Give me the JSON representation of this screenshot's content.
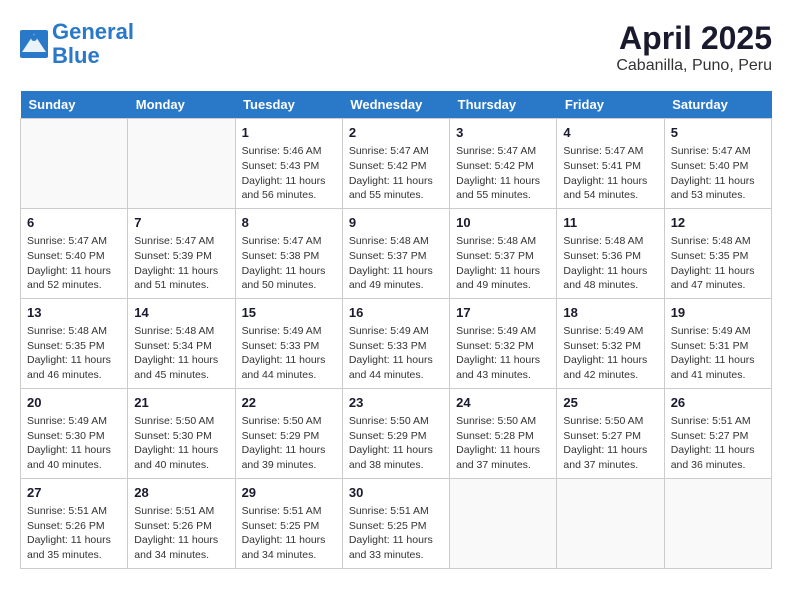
{
  "logo": {
    "line1": "General",
    "line2": "Blue"
  },
  "title": "April 2025",
  "subtitle": "Cabanilla, Puno, Peru",
  "weekdays": [
    "Sunday",
    "Monday",
    "Tuesday",
    "Wednesday",
    "Thursday",
    "Friday",
    "Saturday"
  ],
  "weeks": [
    [
      {
        "day": "",
        "info": ""
      },
      {
        "day": "",
        "info": ""
      },
      {
        "day": "1",
        "info": "Sunrise: 5:46 AM\nSunset: 5:43 PM\nDaylight: 11 hours and 56 minutes."
      },
      {
        "day": "2",
        "info": "Sunrise: 5:47 AM\nSunset: 5:42 PM\nDaylight: 11 hours and 55 minutes."
      },
      {
        "day": "3",
        "info": "Sunrise: 5:47 AM\nSunset: 5:42 PM\nDaylight: 11 hours and 55 minutes."
      },
      {
        "day": "4",
        "info": "Sunrise: 5:47 AM\nSunset: 5:41 PM\nDaylight: 11 hours and 54 minutes."
      },
      {
        "day": "5",
        "info": "Sunrise: 5:47 AM\nSunset: 5:40 PM\nDaylight: 11 hours and 53 minutes."
      }
    ],
    [
      {
        "day": "6",
        "info": "Sunrise: 5:47 AM\nSunset: 5:40 PM\nDaylight: 11 hours and 52 minutes."
      },
      {
        "day": "7",
        "info": "Sunrise: 5:47 AM\nSunset: 5:39 PM\nDaylight: 11 hours and 51 minutes."
      },
      {
        "day": "8",
        "info": "Sunrise: 5:47 AM\nSunset: 5:38 PM\nDaylight: 11 hours and 50 minutes."
      },
      {
        "day": "9",
        "info": "Sunrise: 5:48 AM\nSunset: 5:37 PM\nDaylight: 11 hours and 49 minutes."
      },
      {
        "day": "10",
        "info": "Sunrise: 5:48 AM\nSunset: 5:37 PM\nDaylight: 11 hours and 49 minutes."
      },
      {
        "day": "11",
        "info": "Sunrise: 5:48 AM\nSunset: 5:36 PM\nDaylight: 11 hours and 48 minutes."
      },
      {
        "day": "12",
        "info": "Sunrise: 5:48 AM\nSunset: 5:35 PM\nDaylight: 11 hours and 47 minutes."
      }
    ],
    [
      {
        "day": "13",
        "info": "Sunrise: 5:48 AM\nSunset: 5:35 PM\nDaylight: 11 hours and 46 minutes."
      },
      {
        "day": "14",
        "info": "Sunrise: 5:48 AM\nSunset: 5:34 PM\nDaylight: 11 hours and 45 minutes."
      },
      {
        "day": "15",
        "info": "Sunrise: 5:49 AM\nSunset: 5:33 PM\nDaylight: 11 hours and 44 minutes."
      },
      {
        "day": "16",
        "info": "Sunrise: 5:49 AM\nSunset: 5:33 PM\nDaylight: 11 hours and 44 minutes."
      },
      {
        "day": "17",
        "info": "Sunrise: 5:49 AM\nSunset: 5:32 PM\nDaylight: 11 hours and 43 minutes."
      },
      {
        "day": "18",
        "info": "Sunrise: 5:49 AM\nSunset: 5:32 PM\nDaylight: 11 hours and 42 minutes."
      },
      {
        "day": "19",
        "info": "Sunrise: 5:49 AM\nSunset: 5:31 PM\nDaylight: 11 hours and 41 minutes."
      }
    ],
    [
      {
        "day": "20",
        "info": "Sunrise: 5:49 AM\nSunset: 5:30 PM\nDaylight: 11 hours and 40 minutes."
      },
      {
        "day": "21",
        "info": "Sunrise: 5:50 AM\nSunset: 5:30 PM\nDaylight: 11 hours and 40 minutes."
      },
      {
        "day": "22",
        "info": "Sunrise: 5:50 AM\nSunset: 5:29 PM\nDaylight: 11 hours and 39 minutes."
      },
      {
        "day": "23",
        "info": "Sunrise: 5:50 AM\nSunset: 5:29 PM\nDaylight: 11 hours and 38 minutes."
      },
      {
        "day": "24",
        "info": "Sunrise: 5:50 AM\nSunset: 5:28 PM\nDaylight: 11 hours and 37 minutes."
      },
      {
        "day": "25",
        "info": "Sunrise: 5:50 AM\nSunset: 5:27 PM\nDaylight: 11 hours and 37 minutes."
      },
      {
        "day": "26",
        "info": "Sunrise: 5:51 AM\nSunset: 5:27 PM\nDaylight: 11 hours and 36 minutes."
      }
    ],
    [
      {
        "day": "27",
        "info": "Sunrise: 5:51 AM\nSunset: 5:26 PM\nDaylight: 11 hours and 35 minutes."
      },
      {
        "day": "28",
        "info": "Sunrise: 5:51 AM\nSunset: 5:26 PM\nDaylight: 11 hours and 34 minutes."
      },
      {
        "day": "29",
        "info": "Sunrise: 5:51 AM\nSunset: 5:25 PM\nDaylight: 11 hours and 34 minutes."
      },
      {
        "day": "30",
        "info": "Sunrise: 5:51 AM\nSunset: 5:25 PM\nDaylight: 11 hours and 33 minutes."
      },
      {
        "day": "",
        "info": ""
      },
      {
        "day": "",
        "info": ""
      },
      {
        "day": "",
        "info": ""
      }
    ]
  ]
}
